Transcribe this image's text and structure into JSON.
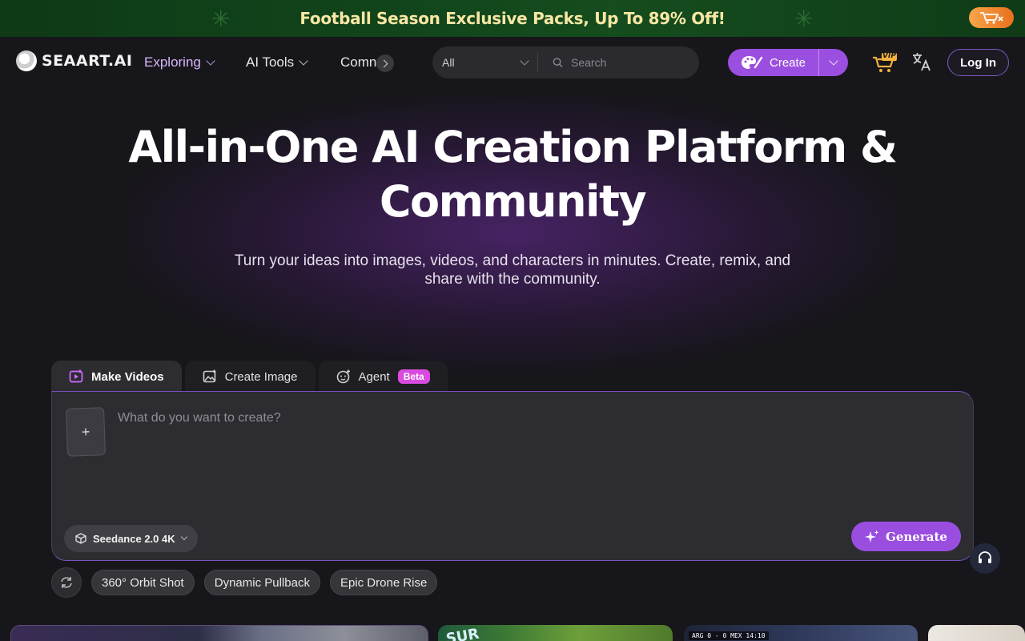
{
  "promo": {
    "text": "Football Season Exclusive Packs, Up To 89% Off!"
  },
  "nav": {
    "logo_text": "SEAART.AI",
    "items": [
      {
        "label": "Exploring",
        "active": true
      },
      {
        "label": "AI Tools",
        "active": false
      },
      {
        "label": "Comn",
        "active": false
      }
    ],
    "search": {
      "category": "All",
      "placeholder": "Search"
    },
    "create_label": "Create",
    "login_label": "Log In",
    "vip_text": "VIP"
  },
  "hero": {
    "title_line1": "All-in-One AI Creation Platform &",
    "title_line2": "Community",
    "subtitle_line1": "Turn your ideas into images, videos, and characters in minutes. Create, remix, and",
    "subtitle_line2": "share with the community."
  },
  "tabs": [
    {
      "label": "Make Videos",
      "active": true,
      "icon": "video-plus-icon"
    },
    {
      "label": "Create Image",
      "active": false,
      "icon": "image-plus-icon"
    },
    {
      "label": "Agent",
      "active": false,
      "icon": "agent-sparkle-icon",
      "badge": "Beta"
    }
  ],
  "composer": {
    "upload_symbol": "+",
    "placeholder": "What do you want to create?",
    "model": "Seedance 2.0 4K",
    "generate_label": "Generate"
  },
  "suggestions": [
    "360° Orbit Shot",
    "Dynamic Pullback",
    "Epic Drone Rise"
  ],
  "gallery": {
    "card3_score": "ARG 0 - 0 MEX 14:10"
  },
  "colors": {
    "accent": "#9b4fe0",
    "background": "#17161a",
    "promo_text": "#f8e7a4"
  }
}
